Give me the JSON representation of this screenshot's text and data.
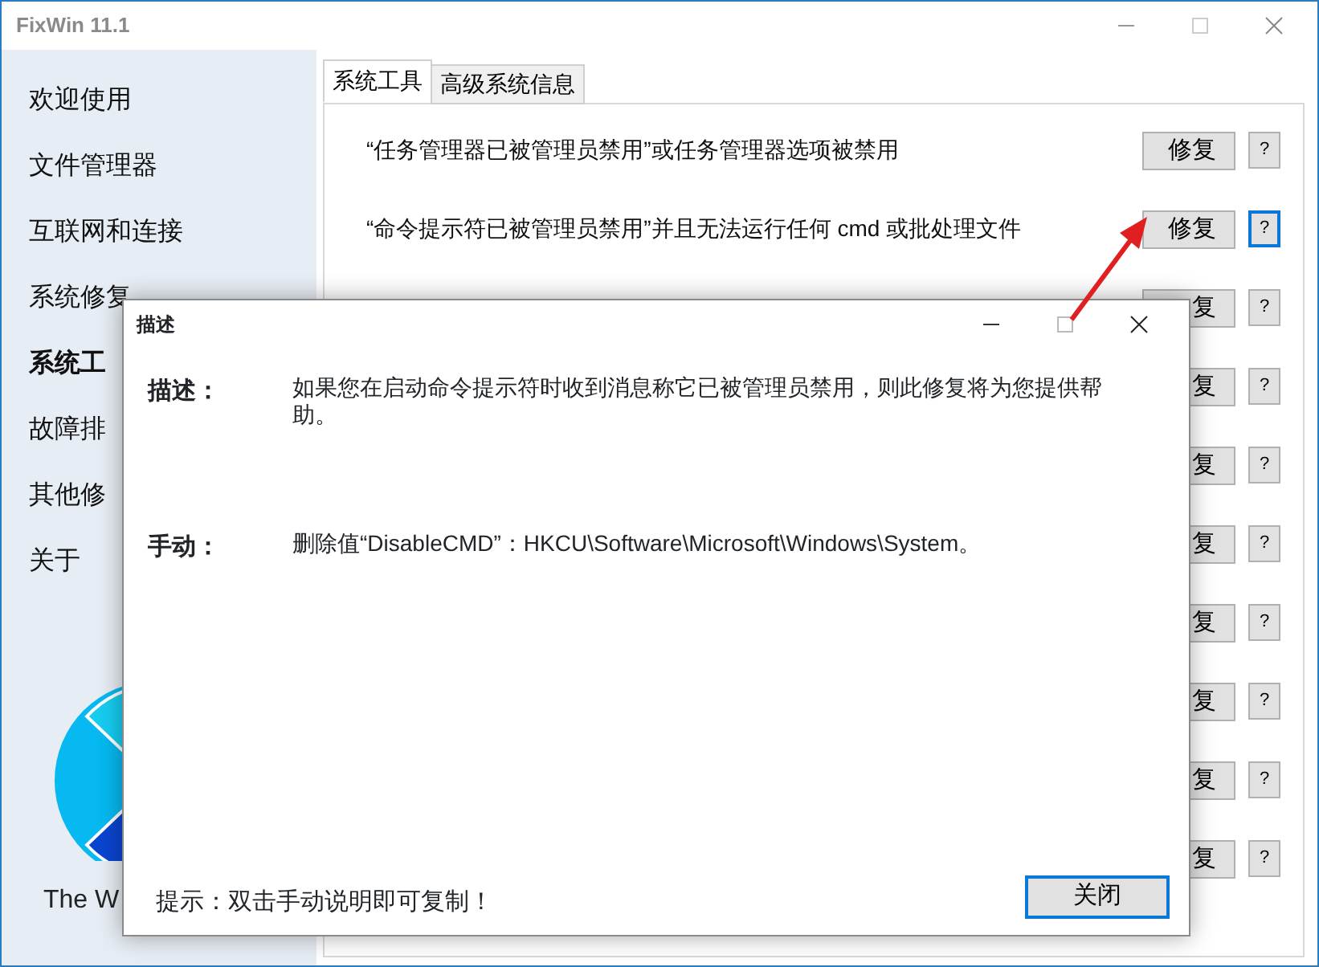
{
  "window": {
    "title": "FixWin 11.1"
  },
  "sidebar": {
    "items": [
      {
        "label": "欢迎使用",
        "selected": false
      },
      {
        "label": "文件管理器",
        "selected": false
      },
      {
        "label": "互联网和连接",
        "selected": false
      },
      {
        "label": "系统修复",
        "selected": false
      },
      {
        "label": "系统工",
        "selected": true
      },
      {
        "label": "故障排",
        "selected": false
      },
      {
        "label": "其他修",
        "selected": false
      },
      {
        "label": "关于",
        "selected": false
      }
    ],
    "footer": "The W"
  },
  "tabs": [
    {
      "label": "系统工具",
      "selected": true
    },
    {
      "label": "高级系统信息",
      "selected": false
    }
  ],
  "fixes": [
    {
      "text": "“任务管理器已被管理员禁用”或任务管理器选项被禁用",
      "button": "修复",
      "help": "?",
      "focused": false
    },
    {
      "text": "“命令提示符已被管理员禁用”并且无法运行任何 cmd 或批处理文件",
      "button": "修复",
      "help": "?",
      "focused": true
    },
    {
      "button": "复",
      "help": "?",
      "focused": false
    },
    {
      "button": "复",
      "help": "?",
      "focused": false
    },
    {
      "button": "复",
      "help": "?",
      "focused": false
    },
    {
      "button": "复",
      "help": "?",
      "focused": false
    },
    {
      "button": "复",
      "help": "?",
      "focused": false
    },
    {
      "button": "复",
      "help": "?",
      "focused": false
    },
    {
      "button": "复",
      "help": "?",
      "focused": false
    },
    {
      "button": "复",
      "help": "?",
      "focused": false
    }
  ],
  "dialog": {
    "title": "描述",
    "description_label": "描述：",
    "description": "如果您在启动命令提示符时收到消息称它已被管理员禁用，则此修复将为您提供帮助。",
    "manual_label": "手动：",
    "manual": "删除值“DisableCMD”：HKCU\\Software\\Microsoft\\Windows\\System。",
    "hint": "提示：双击手动说明即可复制！",
    "close_button": {
      "label": "关闭",
      "focused": true
    }
  }
}
